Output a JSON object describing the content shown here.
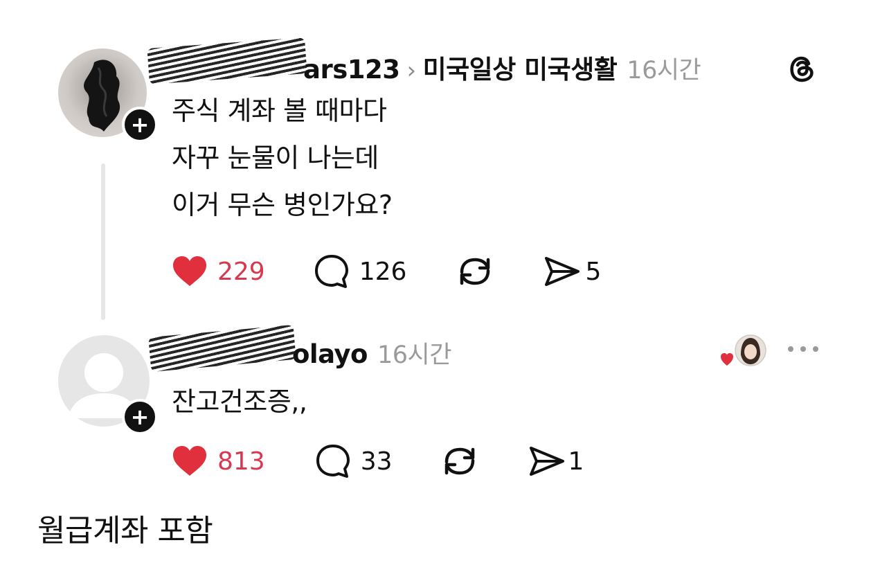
{
  "post": {
    "username_visible": "ars123",
    "topic": "미국일상 미국생활",
    "separator": "›",
    "time": "16시간",
    "lines": [
      "주식 계좌 볼 때마다",
      "자꾸 눈물이 나는데",
      "이거 무슨 병인가요?"
    ],
    "likes": "229",
    "comments": "126",
    "shares": "5"
  },
  "reply": {
    "username_visible": "olayo",
    "time": "16시간",
    "text": "잔고건조증,,",
    "likes": "813",
    "comments": "33",
    "shares": "1"
  },
  "follow_badge": "+",
  "caption": "월급계좌 포함",
  "colors": {
    "like": "#e0303e",
    "like_count": "#d63850",
    "muted": "#9a9a9a",
    "thread_line": "#e6e6e6"
  },
  "icons": [
    "threads-logo-icon",
    "heart-icon",
    "comment-icon",
    "repost-icon",
    "share-icon",
    "more-icon",
    "plus-icon"
  ]
}
